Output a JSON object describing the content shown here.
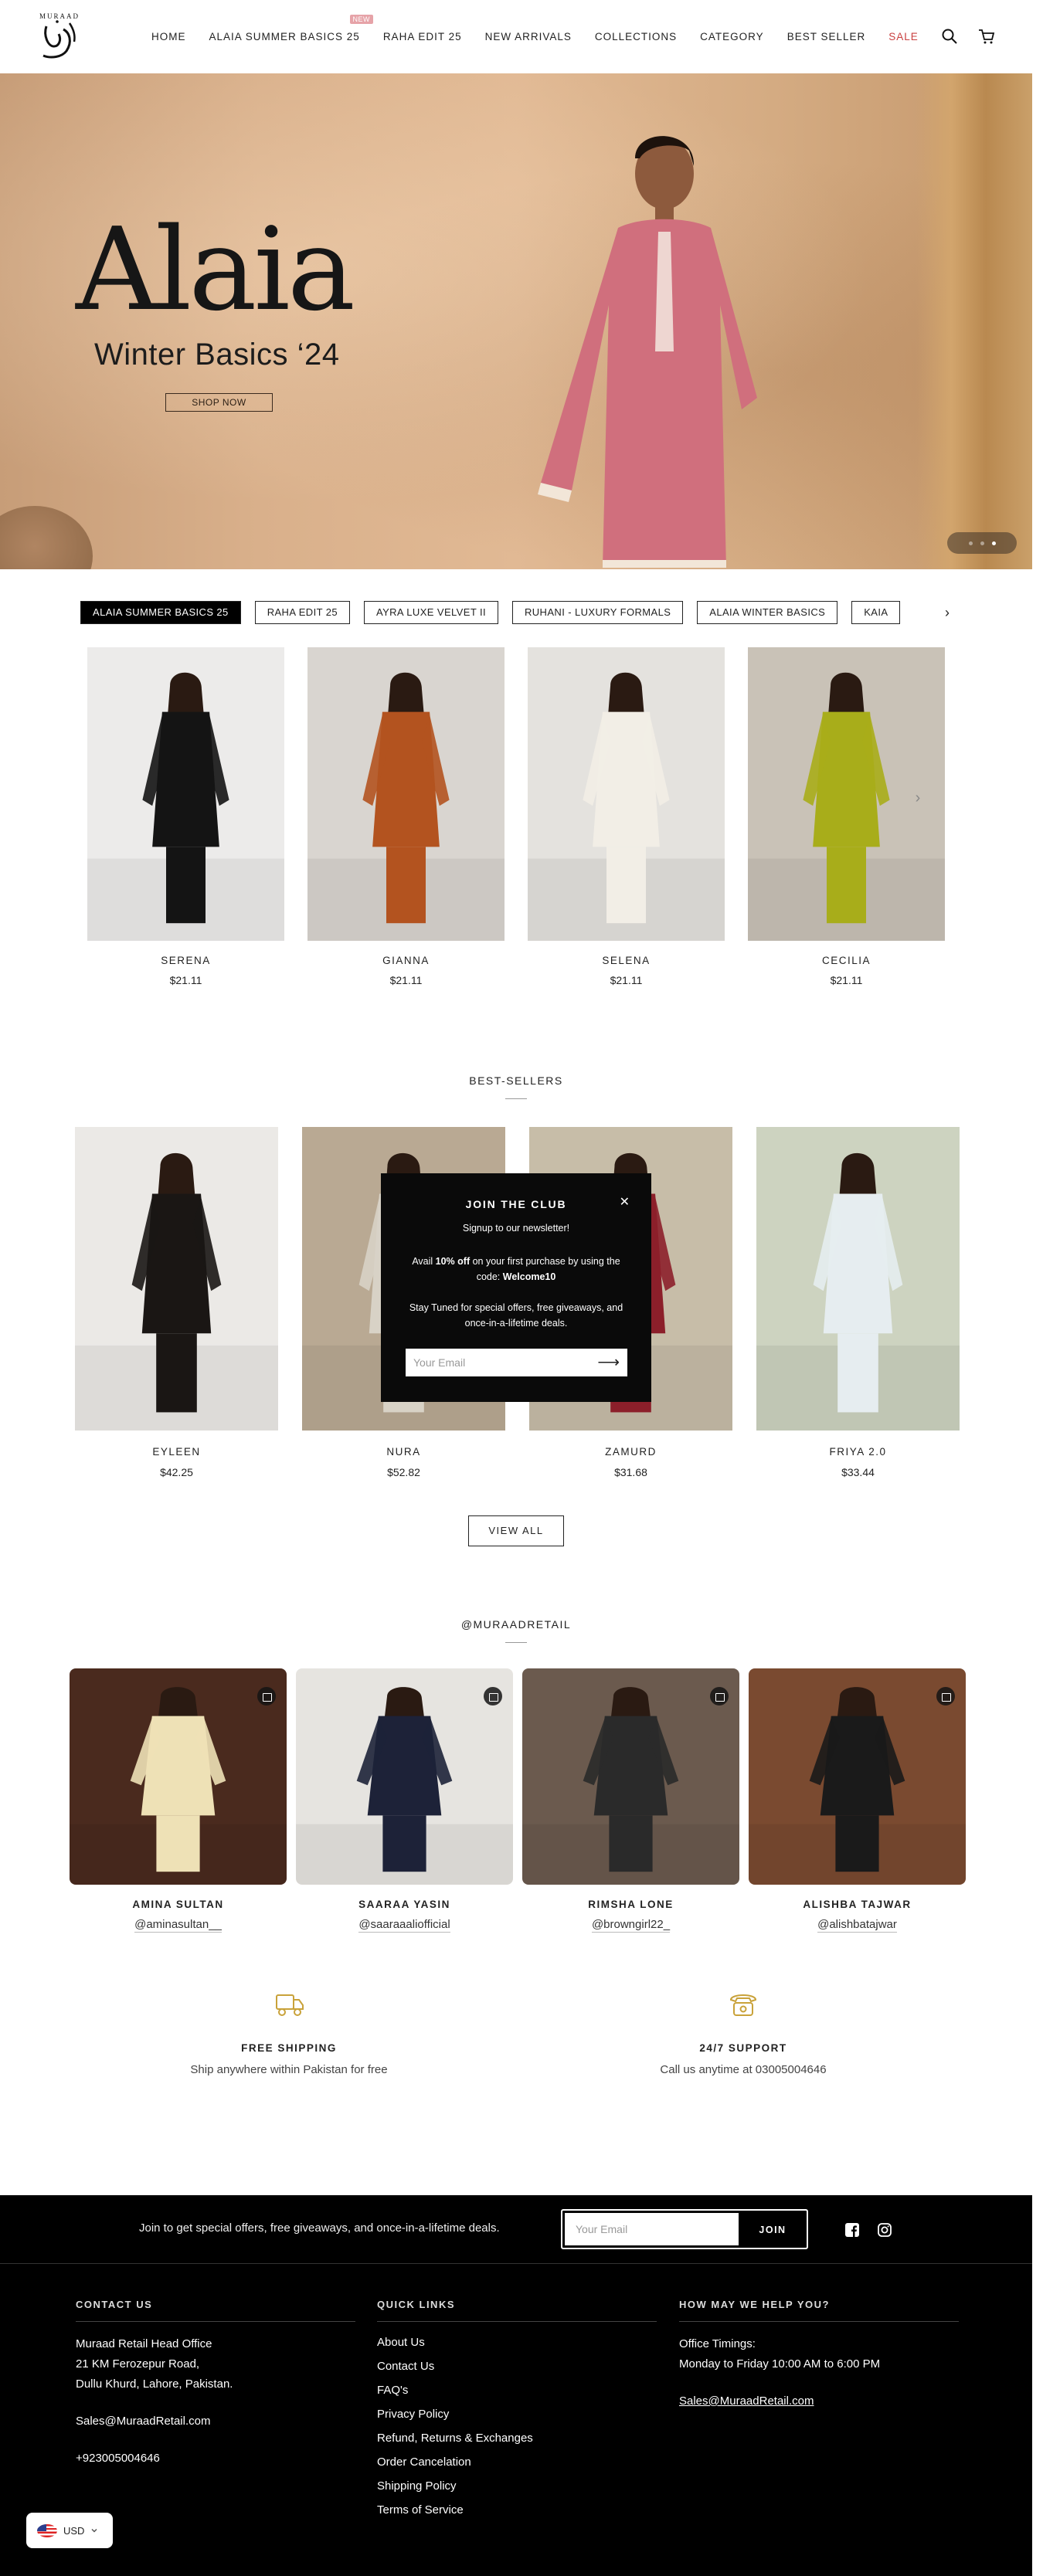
{
  "brand": {
    "logo_text": "MURAAD"
  },
  "nav": {
    "items": [
      "Home",
      "Alaia Summer Basics 25",
      "Raha Edit 25",
      "New Arrivals",
      "Collections",
      "Category",
      "Best Seller",
      "Sale"
    ],
    "badge": "NEW"
  },
  "hero": {
    "title": "Alaia",
    "subtitle": "Winter Basics ‘24",
    "cta": "SHOP NOW",
    "slides": 3,
    "active_slide": 3
  },
  "collection_tabs": {
    "items": [
      "ALAIA SUMMER BASICS 25",
      "RAHA EDIT 25",
      "AYRA LUXE VELVET II",
      "RUHANI - LUXURY FORMALS",
      "ALAIA WINTER BASICS",
      "KAIA"
    ],
    "active": 0
  },
  "collection_products": [
    {
      "name": "SERENA",
      "price": "$21.11",
      "color": "#141414",
      "bg": "#ecebea"
    },
    {
      "name": "GIANNA",
      "price": "$21.11",
      "color": "#b3531f",
      "bg": "#d9d5d0"
    },
    {
      "name": "SELENA",
      "price": "$21.11",
      "color": "#f2eee6",
      "bg": "#e4e2de"
    },
    {
      "name": "CECILIA",
      "price": "$21.11",
      "color": "#a8ad1a",
      "bg": "#c9c2b7"
    }
  ],
  "best_sellers": {
    "title": "BEST-SELLERS",
    "products": [
      {
        "name": "EYLEEN",
        "price": "$42.25",
        "color": "#1a1614",
        "bg": "#ebe9e6"
      },
      {
        "name": "NURA",
        "price": "$52.82",
        "color": "#d8d2c6",
        "bg": "#b9a993"
      },
      {
        "name": "ZAMURD",
        "price": "$31.68",
        "color": "#8c1f2a",
        "bg": "#c7bda8"
      },
      {
        "name": "FRIYA 2.0",
        "price": "$33.44",
        "color": "#e6edf0",
        "bg": "#cdd3c0"
      }
    ],
    "view_all": "VIEW ALL"
  },
  "popup": {
    "title": "JOIN THE CLUB",
    "subtitle": "Signup to our newsletter!",
    "offer_prefix": "Avail ",
    "offer_bold": "10% off",
    "offer_mid": " on your first purchase by using the code: ",
    "offer_code": "Welcome10",
    "tagline": "Stay Tuned for special offers, free giveaways, and once-in-a-lifetime deals.",
    "email_placeholder": "Your Email",
    "close": "✕"
  },
  "instagram": {
    "title": "@MURAADRETAIL",
    "posts": [
      {
        "name": "AMINA SULTAN",
        "handle": "@aminasultan__",
        "color": "#eee1b6",
        "bg": "#4a2a1e"
      },
      {
        "name": "SAARAA YASIN",
        "handle": "@saaraaaliofficial",
        "color": "#1d2238",
        "bg": "#e6e4e0"
      },
      {
        "name": "RIMSHA LONE",
        "handle": "@browngirl22_",
        "color": "#2a2a2a",
        "bg": "#6b5a4e"
      },
      {
        "name": "ALISHBA TAJWAR",
        "handle": "@alishbatajwar",
        "color": "#1a1a1a",
        "bg": "#7a4a30"
      }
    ]
  },
  "features": [
    {
      "title": "FREE SHIPPING",
      "desc": "Ship anywhere within Pakistan for free",
      "icon": "truck-icon"
    },
    {
      "title": "24/7 SUPPORT",
      "desc": "Call us anytime at 03005004646",
      "icon": "phone-icon"
    }
  ],
  "footer": {
    "newsletter_text": "Join to get special offers, free giveaways, and once-in-a-lifetime deals.",
    "email_placeholder": "Your Email",
    "join": "JOIN",
    "contact": {
      "heading": "CONTACT US",
      "address_1": "Muraad Retail Head Office",
      "address_2": "21 KM Ferozepur Road,",
      "address_3": "Dullu Khurd, Lahore, Pakistan.",
      "email": "Sales@MuraadRetail.com",
      "phone": "+923005004646"
    },
    "quick_links": {
      "heading": "QUICK LINKS",
      "items": [
        "About Us",
        "Contact Us",
        "FAQ's",
        "Privacy Policy",
        "Refund, Returns & Exchanges",
        "Order Cancelation",
        "Shipping Policy",
        "Terms of Service"
      ]
    },
    "help": {
      "heading": "HOW MAY WE HELP YOU?",
      "timings_label": "Office Timings:",
      "timings": "Monday to Friday 10:00 AM to 6:00 PM",
      "email": "Sales@MuraadRetail.com"
    }
  },
  "currency": {
    "code": "USD"
  },
  "colors": {
    "accent_sale": "#c94040",
    "footer_bg": "#000000",
    "feature_icon": "#c9a23a"
  }
}
